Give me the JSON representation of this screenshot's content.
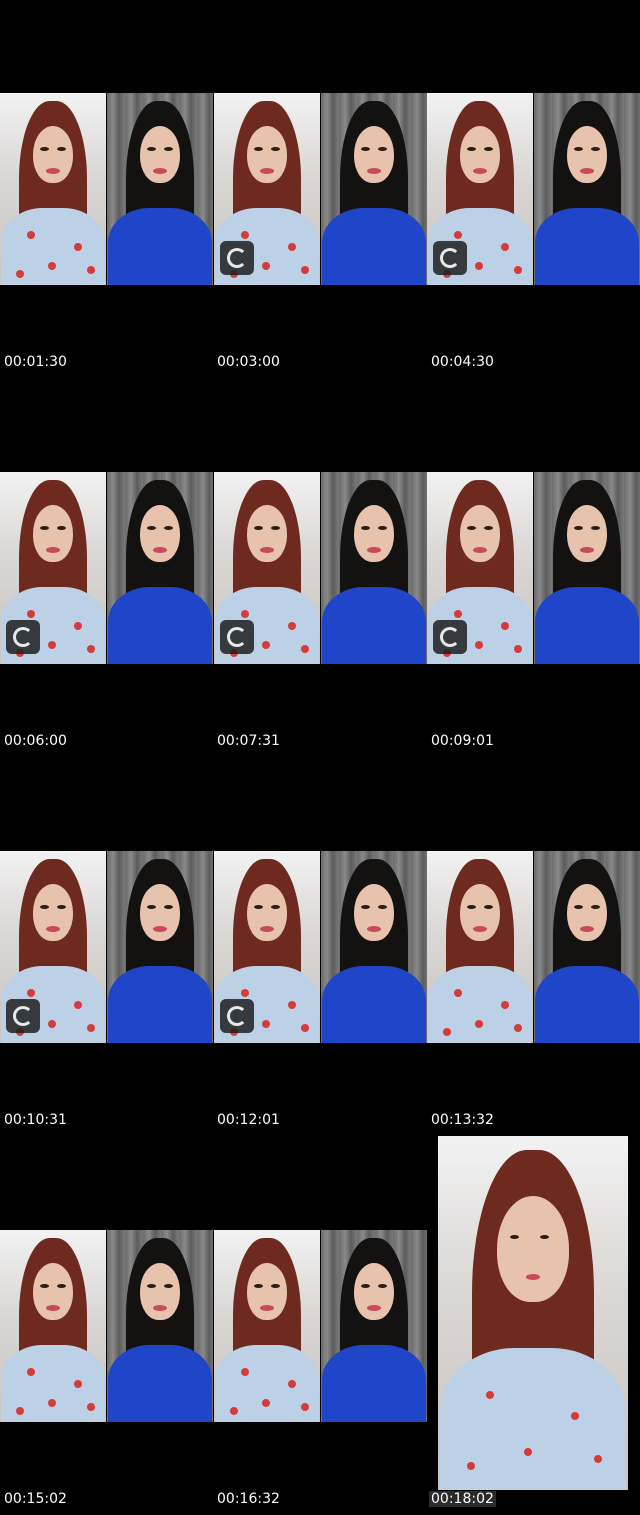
{
  "timestamps": [
    "00:01:30",
    "00:03:00",
    "00:04:30",
    "00:06:00",
    "00:07:31",
    "00:09:01",
    "00:10:31",
    "00:12:01",
    "00:13:32",
    "00:15:02",
    "00:16:32",
    "00:18:02"
  ],
  "colors": {
    "background": "#000000",
    "timestamp_text": "#ffffff",
    "blue_top": "#1f46c8",
    "pink_lips": "#c64a5a"
  },
  "icons": {
    "overlay_badge": "sticker-badge-icon"
  }
}
